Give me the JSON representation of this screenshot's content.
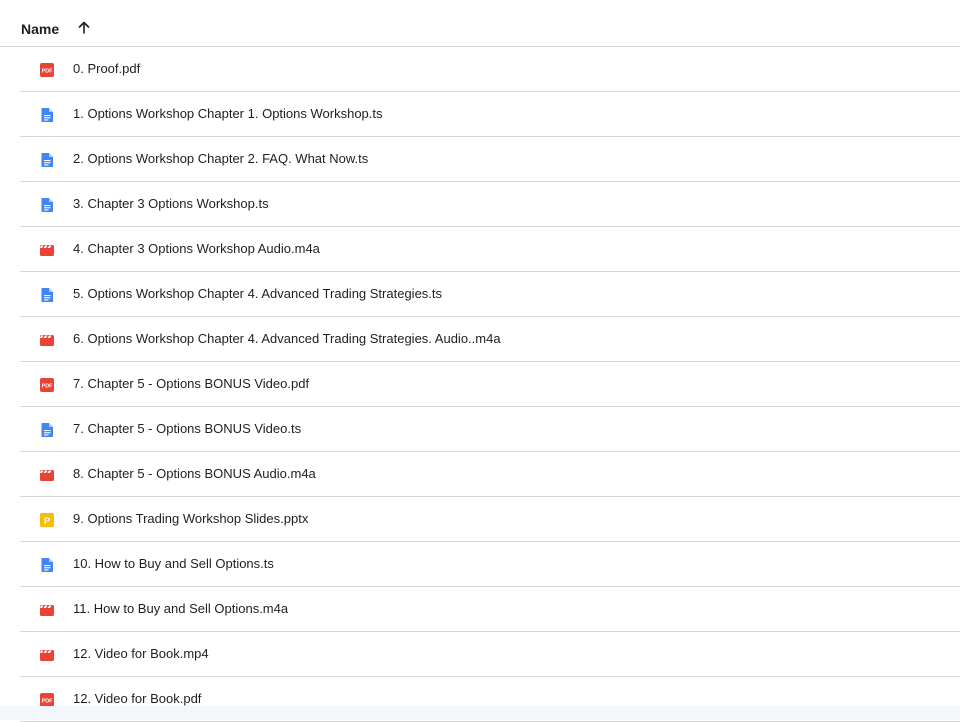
{
  "header": {
    "name_label": "Name"
  },
  "colors": {
    "pdf": "#ea4335",
    "doc": "#4285f4",
    "video": "#ea4335",
    "slides": "#fbbc04"
  },
  "files": [
    {
      "name": "0. Proof.pdf",
      "icon": "pdf-icon"
    },
    {
      "name": "1. Options Workshop Chapter 1. Options Workshop.ts",
      "icon": "document-icon"
    },
    {
      "name": "2. Options Workshop Chapter 2. FAQ. What Now.ts",
      "icon": "document-icon"
    },
    {
      "name": "3. Chapter 3 Options Workshop.ts",
      "icon": "document-icon"
    },
    {
      "name": "4. Chapter 3 Options Workshop Audio.m4a",
      "icon": "video-icon"
    },
    {
      "name": "5. Options Workshop Chapter 4. Advanced Trading Strategies.ts",
      "icon": "document-icon"
    },
    {
      "name": "6. Options Workshop Chapter 4. Advanced Trading Strategies. Audio..m4a",
      "icon": "video-icon"
    },
    {
      "name": "7. Chapter 5 - Options BONUS Video.pdf",
      "icon": "pdf-icon"
    },
    {
      "name": "7. Chapter 5 - Options BONUS Video.ts",
      "icon": "document-icon"
    },
    {
      "name": "8. Chapter 5 - Options BONUS Audio.m4a",
      "icon": "video-icon"
    },
    {
      "name": "9. Options Trading Workshop Slides.pptx",
      "icon": "slides-icon"
    },
    {
      "name": "10. How to Buy and Sell Options.ts",
      "icon": "document-icon"
    },
    {
      "name": "11. How to Buy and Sell Options.m4a",
      "icon": "video-icon"
    },
    {
      "name": "12. Video for Book.mp4",
      "icon": "video-icon"
    },
    {
      "name": "12. Video for Book.pdf",
      "icon": "pdf-icon"
    }
  ]
}
